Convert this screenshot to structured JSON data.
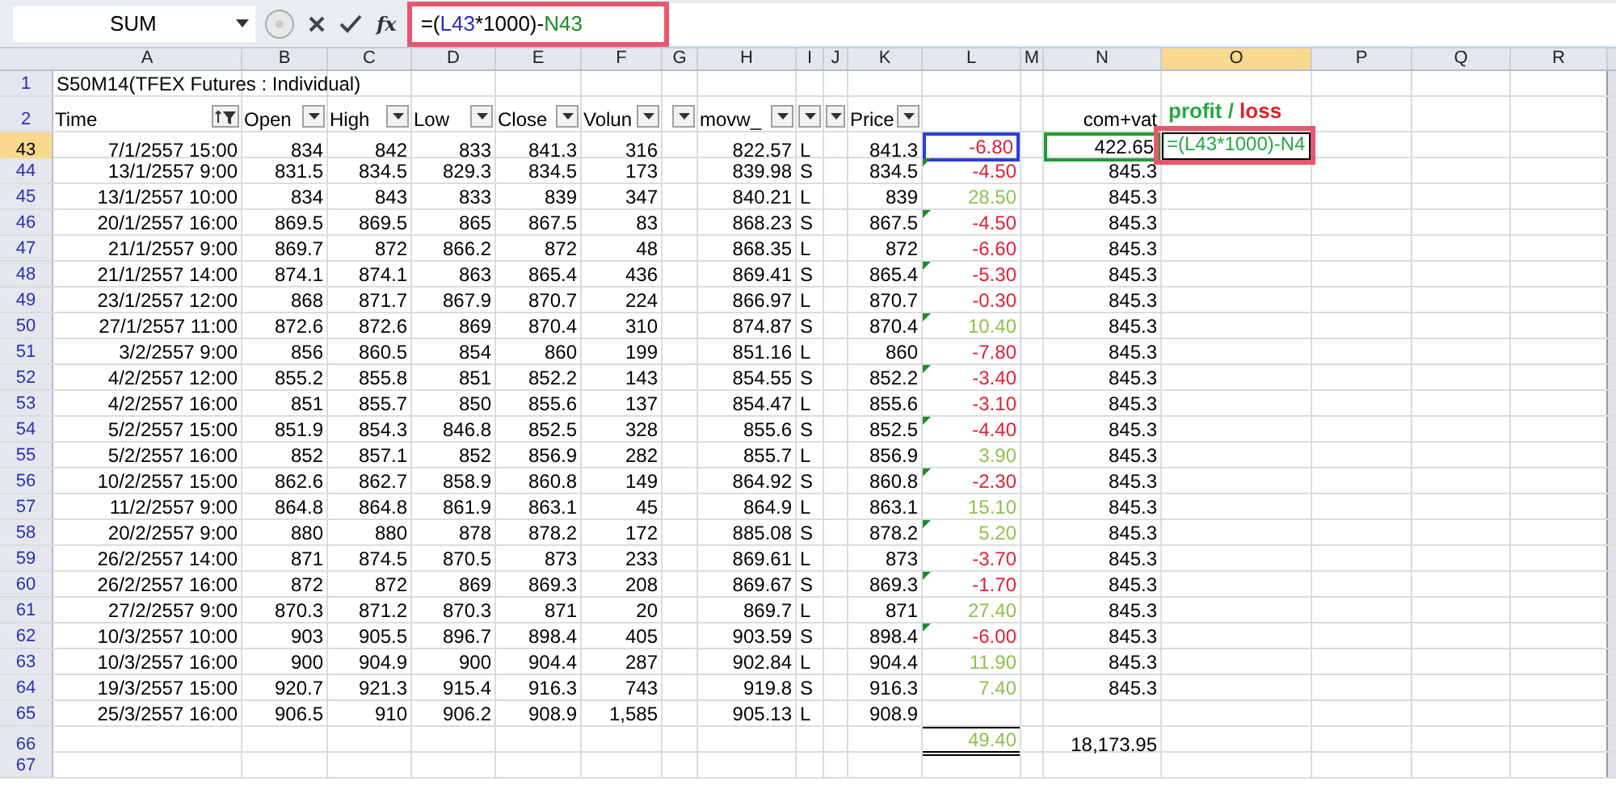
{
  "formula_bar": {
    "name_box": "SUM",
    "function_button": "fx",
    "highlighted": true,
    "formula": [
      {
        "text": "=(",
        "color": "#000000"
      },
      {
        "text": "L43",
        "color": "#2b2bc8"
      },
      {
        "text": "*1000)-",
        "color": "#000000"
      },
      {
        "text": "N43",
        "color": "#1f8a2a"
      }
    ]
  },
  "columns": [
    {
      "label": "A",
      "selected": false
    },
    {
      "label": "B",
      "selected": false
    },
    {
      "label": "C",
      "selected": false
    },
    {
      "label": "D",
      "selected": false
    },
    {
      "label": "E",
      "selected": false
    },
    {
      "label": "F",
      "selected": false
    },
    {
      "label": "G",
      "selected": false
    },
    {
      "label": "H",
      "selected": false
    },
    {
      "label": "I",
      "selected": false
    },
    {
      "label": "J",
      "selected": false
    },
    {
      "label": "K",
      "selected": false
    },
    {
      "label": "L",
      "selected": false
    },
    {
      "label": "M",
      "selected": false
    },
    {
      "label": "N",
      "selected": false
    },
    {
      "label": "O",
      "selected": true
    },
    {
      "label": "P",
      "selected": false
    },
    {
      "label": "Q",
      "selected": false
    },
    {
      "label": "R",
      "selected": false
    }
  ],
  "rows": [
    {
      "kind": "title",
      "number": "1",
      "selected": false,
      "title": "S50M14(TFEX Futures : Individual)"
    },
    {
      "kind": "header",
      "number": "2",
      "selected": false,
      "time": {
        "text": "Time",
        "kind": "sorted"
      },
      "open": {
        "text": "Open",
        "kind": "plain"
      },
      "high": {
        "text": "High",
        "kind": "plain"
      },
      "low": {
        "text": "Low",
        "kind": "plain"
      },
      "close": {
        "text": "Close",
        "kind": "plain"
      },
      "volume": {
        "text": "Volun",
        "kind": "plain"
      },
      "col_g": {
        "kind": "plain"
      },
      "movw": {
        "text": "movw_",
        "kind": "plain"
      },
      "col_i": {
        "kind": "plain"
      },
      "col_j": {
        "kind": "plain"
      },
      "price": {
        "text": "Price",
        "kind": "plain"
      },
      "comvat": "com+vat",
      "profit_loss": [
        {
          "text": "profit /",
          "color": "#27a745"
        },
        {
          "text": " loss",
          "color": "#e0202a"
        }
      ]
    },
    {
      "kind": "data",
      "number": "43",
      "selected": true,
      "time": "7/1/2557 15:00",
      "open": "834",
      "high": "842",
      "low": "833",
      "close": "841.3",
      "volume": "316",
      "movw": "822.57",
      "side": "L",
      "price": "841.3",
      "pl": {
        "text": "-6.80",
        "color": "#e0203a",
        "flag": false,
        "ref": true
      },
      "comvat": "422.65",
      "comvat_ref": true,
      "editing": "=(L43*1000)-N4",
      "edit_highlighted": true
    },
    {
      "kind": "data",
      "number": "44",
      "selected": false,
      "time": "13/1/2557 9:00",
      "open": "831.5",
      "high": "834.5",
      "low": "829.3",
      "close": "834.5",
      "volume": "173",
      "movw": "839.98",
      "side": "S",
      "price": "834.5",
      "pl": {
        "text": "-4.50",
        "color": "#e0203a",
        "flag": true
      },
      "comvat": "845.3"
    },
    {
      "kind": "data",
      "number": "45",
      "selected": false,
      "time": "13/1/2557 10:00",
      "open": "834",
      "high": "843",
      "low": "833",
      "close": "839",
      "volume": "347",
      "movw": "840.21",
      "side": "L",
      "price": "839",
      "pl": {
        "text": "28.50",
        "color": "#92c050",
        "flag": false
      },
      "comvat": "845.3"
    },
    {
      "kind": "data",
      "number": "46",
      "selected": false,
      "time": "20/1/2557 16:00",
      "open": "869.5",
      "high": "869.5",
      "low": "865",
      "close": "867.5",
      "volume": "83",
      "movw": "868.23",
      "side": "S",
      "price": "867.5",
      "pl": {
        "text": "-4.50",
        "color": "#e0203a",
        "flag": true
      },
      "comvat": "845.3"
    },
    {
      "kind": "data",
      "number": "47",
      "selected": false,
      "time": "21/1/2557 9:00",
      "open": "869.7",
      "high": "872",
      "low": "866.2",
      "close": "872",
      "volume": "48",
      "movw": "868.35",
      "side": "L",
      "price": "872",
      "pl": {
        "text": "-6.60",
        "color": "#e0203a",
        "flag": false
      },
      "comvat": "845.3"
    },
    {
      "kind": "data",
      "number": "48",
      "selected": false,
      "time": "21/1/2557 14:00",
      "open": "874.1",
      "high": "874.1",
      "low": "863",
      "close": "865.4",
      "volume": "436",
      "movw": "869.41",
      "side": "S",
      "price": "865.4",
      "pl": {
        "text": "-5.30",
        "color": "#e0203a",
        "flag": true
      },
      "comvat": "845.3"
    },
    {
      "kind": "data",
      "number": "49",
      "selected": false,
      "time": "23/1/2557 12:00",
      "open": "868",
      "high": "871.7",
      "low": "867.9",
      "close": "870.7",
      "volume": "224",
      "movw": "866.97",
      "side": "L",
      "price": "870.7",
      "pl": {
        "text": "-0.30",
        "color": "#e0203a",
        "flag": false
      },
      "comvat": "845.3"
    },
    {
      "kind": "data",
      "number": "50",
      "selected": false,
      "time": "27/1/2557 11:00",
      "open": "872.6",
      "high": "872.6",
      "low": "869",
      "close": "870.4",
      "volume": "310",
      "movw": "874.87",
      "side": "S",
      "price": "870.4",
      "pl": {
        "text": "10.40",
        "color": "#92c050",
        "flag": true
      },
      "comvat": "845.3"
    },
    {
      "kind": "data",
      "number": "51",
      "selected": false,
      "time": "3/2/2557 9:00",
      "open": "856",
      "high": "860.5",
      "low": "854",
      "close": "860",
      "volume": "199",
      "movw": "851.16",
      "side": "L",
      "price": "860",
      "pl": {
        "text": "-7.80",
        "color": "#e0203a",
        "flag": false
      },
      "comvat": "845.3"
    },
    {
      "kind": "data",
      "number": "52",
      "selected": false,
      "time": "4/2/2557 12:00",
      "open": "855.2",
      "high": "855.8",
      "low": "851",
      "close": "852.2",
      "volume": "143",
      "movw": "854.55",
      "side": "S",
      "price": "852.2",
      "pl": {
        "text": "-3.40",
        "color": "#e0203a",
        "flag": true
      },
      "comvat": "845.3"
    },
    {
      "kind": "data",
      "number": "53",
      "selected": false,
      "time": "4/2/2557 16:00",
      "open": "851",
      "high": "855.7",
      "low": "850",
      "close": "855.6",
      "volume": "137",
      "movw": "854.47",
      "side": "L",
      "price": "855.6",
      "pl": {
        "text": "-3.10",
        "color": "#e0203a",
        "flag": false
      },
      "comvat": "845.3"
    },
    {
      "kind": "data",
      "number": "54",
      "selected": false,
      "time": "5/2/2557 15:00",
      "open": "851.9",
      "high": "854.3",
      "low": "846.8",
      "close": "852.5",
      "volume": "328",
      "movw": "855.6",
      "side": "S",
      "price": "852.5",
      "pl": {
        "text": "-4.40",
        "color": "#e0203a",
        "flag": true
      },
      "comvat": "845.3"
    },
    {
      "kind": "data",
      "number": "55",
      "selected": false,
      "time": "5/2/2557 16:00",
      "open": "852",
      "high": "857.1",
      "low": "852",
      "close": "856.9",
      "volume": "282",
      "movw": "855.7",
      "side": "L",
      "price": "856.9",
      "pl": {
        "text": "3.90",
        "color": "#92c050",
        "flag": false
      },
      "comvat": "845.3"
    },
    {
      "kind": "data",
      "number": "56",
      "selected": false,
      "time": "10/2/2557 15:00",
      "open": "862.6",
      "high": "862.7",
      "low": "858.9",
      "close": "860.8",
      "volume": "149",
      "movw": "864.92",
      "side": "S",
      "price": "860.8",
      "pl": {
        "text": "-2.30",
        "color": "#e0203a",
        "flag": true
      },
      "comvat": "845.3"
    },
    {
      "kind": "data",
      "number": "57",
      "selected": false,
      "time": "11/2/2557 9:00",
      "open": "864.8",
      "high": "864.8",
      "low": "861.9",
      "close": "863.1",
      "volume": "45",
      "movw": "864.9",
      "side": "L",
      "price": "863.1",
      "pl": {
        "text": "15.10",
        "color": "#92c050",
        "flag": false
      },
      "comvat": "845.3"
    },
    {
      "kind": "data",
      "number": "58",
      "selected": false,
      "time": "20/2/2557 9:00",
      "open": "880",
      "high": "880",
      "low": "878",
      "close": "878.2",
      "volume": "172",
      "movw": "885.08",
      "side": "S",
      "price": "878.2",
      "pl": {
        "text": "5.20",
        "color": "#92c050",
        "flag": true
      },
      "comvat": "845.3"
    },
    {
      "kind": "data",
      "number": "59",
      "selected": false,
      "time": "26/2/2557 14:00",
      "open": "871",
      "high": "874.5",
      "low": "870.5",
      "close": "873",
      "volume": "233",
      "movw": "869.61",
      "side": "L",
      "price": "873",
      "pl": {
        "text": "-3.70",
        "color": "#e0203a",
        "flag": false
      },
      "comvat": "845.3"
    },
    {
      "kind": "data",
      "number": "60",
      "selected": false,
      "time": "26/2/2557 16:00",
      "open": "872",
      "high": "872",
      "low": "869",
      "close": "869.3",
      "volume": "208",
      "movw": "869.67",
      "side": "S",
      "price": "869.3",
      "pl": {
        "text": "-1.70",
        "color": "#e0203a",
        "flag": true
      },
      "comvat": "845.3"
    },
    {
      "kind": "data",
      "number": "61",
      "selected": false,
      "time": "27/2/2557 9:00",
      "open": "870.3",
      "high": "871.2",
      "low": "870.3",
      "close": "871",
      "volume": "20",
      "movw": "869.7",
      "side": "L",
      "price": "871",
      "pl": {
        "text": "27.40",
        "color": "#92c050",
        "flag": false
      },
      "comvat": "845.3"
    },
    {
      "kind": "data",
      "number": "62",
      "selected": false,
      "time": "10/3/2557 10:00",
      "open": "903",
      "high": "905.5",
      "low": "896.7",
      "close": "898.4",
      "volume": "405",
      "movw": "903.59",
      "side": "S",
      "price": "898.4",
      "pl": {
        "text": "-6.00",
        "color": "#e0203a",
        "flag": true
      },
      "comvat": "845.3"
    },
    {
      "kind": "data",
      "number": "63",
      "selected": false,
      "time": "10/3/2557 16:00",
      "open": "900",
      "high": "904.9",
      "low": "900",
      "close": "904.4",
      "volume": "287",
      "movw": "902.84",
      "side": "L",
      "price": "904.4",
      "pl": {
        "text": "11.90",
        "color": "#92c050",
        "flag": false
      },
      "comvat": "845.3"
    },
    {
      "kind": "data",
      "number": "64",
      "selected": false,
      "time": "19/3/2557 15:00",
      "open": "920.7",
      "high": "921.3",
      "low": "915.4",
      "close": "916.3",
      "volume": "743",
      "movw": "919.8",
      "side": "S",
      "price": "916.3",
      "pl": {
        "text": "7.40",
        "color": "#92c050",
        "flag": false
      },
      "comvat": "845.3"
    },
    {
      "kind": "data",
      "number": "65",
      "selected": false,
      "time": "25/3/2557 16:00",
      "open": "906.5",
      "high": "910",
      "low": "906.2",
      "close": "908.9",
      "volume": "1,585",
      "movw": "905.13",
      "side": "L",
      "price": "908.9"
    },
    {
      "kind": "total",
      "number": "66",
      "selected": false,
      "pl": {
        "text": "49.40",
        "color": "#92c050"
      },
      "comvat": "18,173.95"
    },
    {
      "kind": "empty",
      "number": "67",
      "selected": false
    }
  ]
}
